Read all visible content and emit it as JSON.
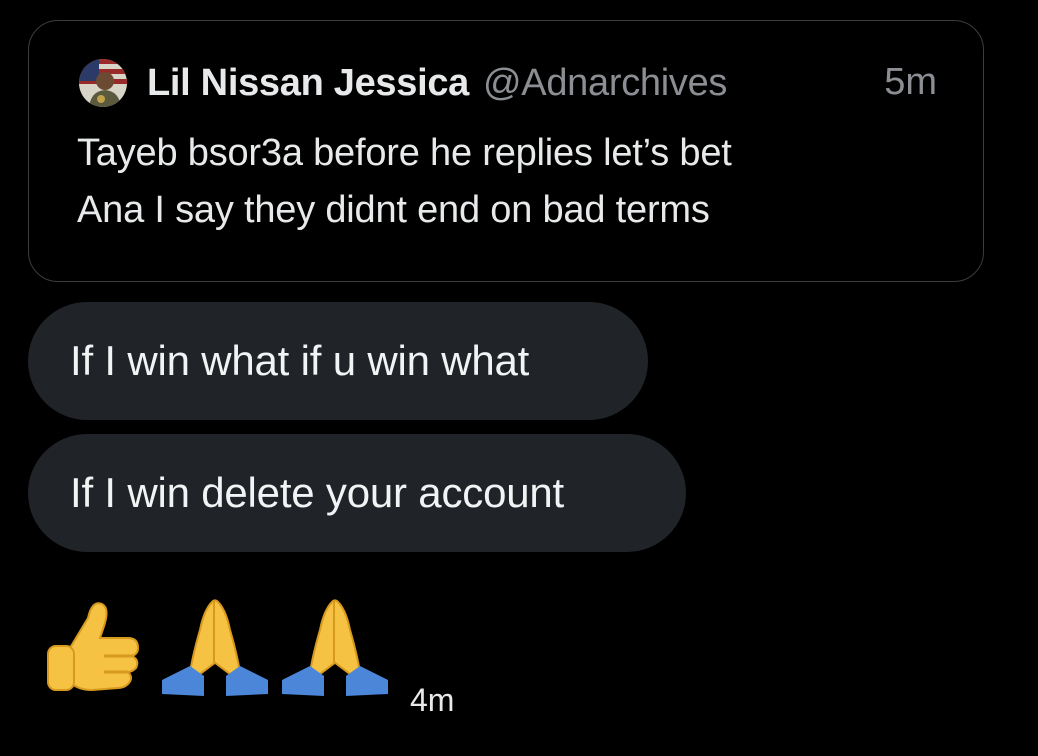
{
  "quoted_tweet": {
    "author_name": "Lil Nissan Jessica",
    "author_handle": "@Adnarchives",
    "time": "5m",
    "text_lines": [
      "Tayeb bsor3a before he replies let’s bet",
      "Ana I say they didnt end on bad terms"
    ],
    "avatar_icon": "avatar-with-flag"
  },
  "messages": [
    {
      "text": "If I win what if u win what"
    },
    {
      "text": "If I win delete your account"
    }
  ],
  "emoji_message": {
    "emojis": [
      "thumbs-up-icon",
      "folded-hands-icon",
      "folded-hands-icon"
    ],
    "time": "4m"
  },
  "colors": {
    "background": "#000000",
    "bubble": "#202327",
    "card_border": "#3a3c40",
    "text_primary": "#e7e9ea",
    "text_secondary": "#8b8f94"
  }
}
